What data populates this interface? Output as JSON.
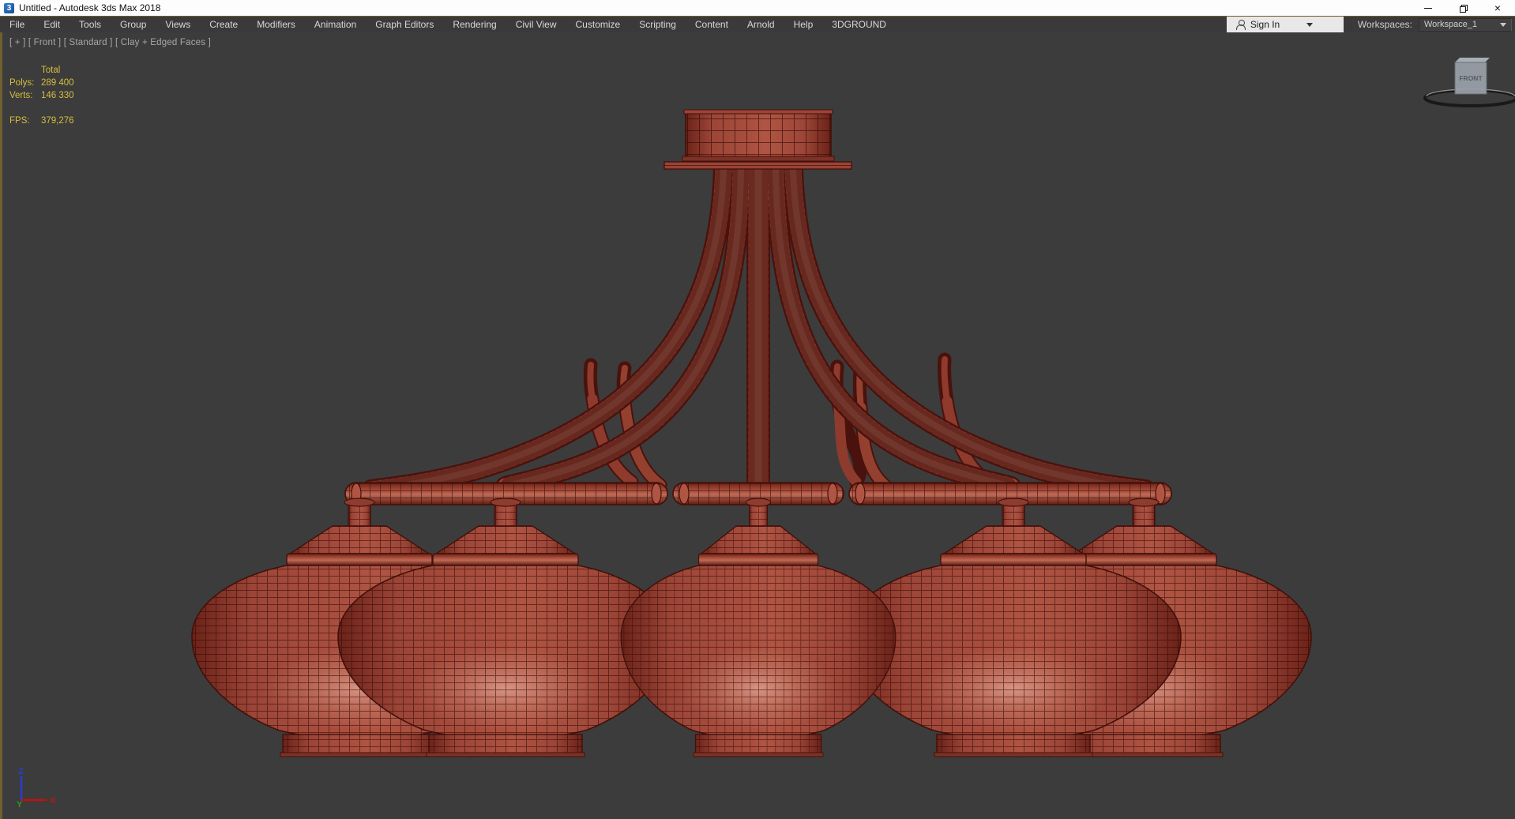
{
  "window": {
    "title": "Untitled - Autodesk 3ds Max 2018",
    "icon_glyph": "3"
  },
  "menu": {
    "items": [
      "File",
      "Edit",
      "Tools",
      "Group",
      "Views",
      "Create",
      "Modifiers",
      "Animation",
      "Graph Editors",
      "Rendering",
      "Civil View",
      "Customize",
      "Scripting",
      "Content",
      "Arnold",
      "Help",
      "3DGROUND"
    ]
  },
  "account": {
    "sign_in_label": "Sign In"
  },
  "workspaces": {
    "label": "Workspaces:",
    "value": "Workspace_1"
  },
  "viewport": {
    "label": "[ + ] [ Front ] [ Standard ] [ Clay + Edged Faces ]",
    "stats": {
      "header": "Total",
      "rows": [
        {
          "label": "Polys:",
          "value": "289 400"
        },
        {
          "label": "Verts:",
          "value": "146 330"
        }
      ],
      "fps_label": "FPS:",
      "fps_value": "379,276"
    },
    "viewcube": {
      "front_label": "FRONT"
    },
    "axis": {
      "x": "X",
      "y": "Y",
      "z": "Z"
    },
    "colors": {
      "background": "#3c3c3c",
      "accent_border": "#6e6030",
      "stats_text": "#d6bf3e",
      "model_base": "#a34a3c",
      "model_edge": "#42100a"
    }
  }
}
